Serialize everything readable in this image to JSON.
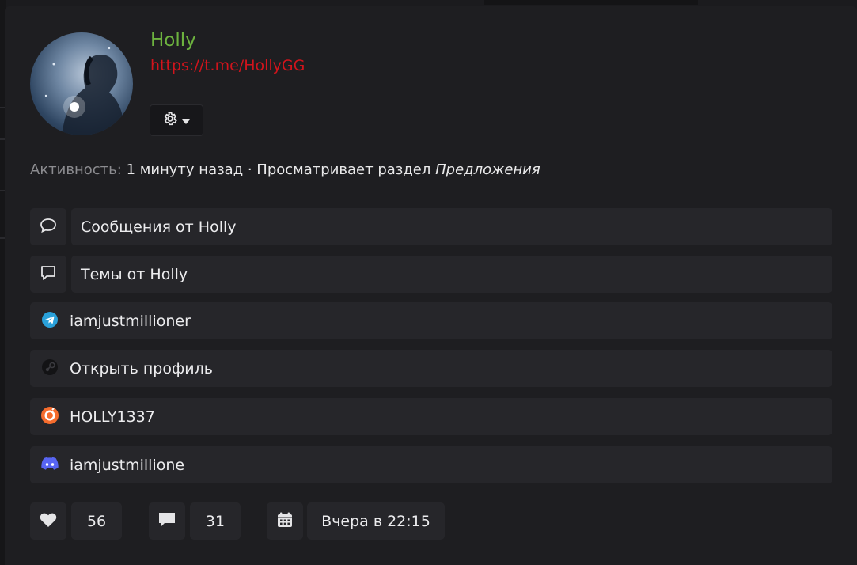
{
  "profile": {
    "name": "Holly",
    "link": "https://t.me/HollyGG"
  },
  "activity": {
    "label": "Активность:",
    "text": "1 минуту назад · Просматривает раздел",
    "section": "Предложения"
  },
  "links": [
    {
      "icon": "chat-bubble-icon",
      "label": "Сообщения от Holly"
    },
    {
      "icon": "topic-icon",
      "label": "Темы от Holly"
    },
    {
      "icon": "telegram-icon",
      "label": "iamjustmillioner"
    },
    {
      "icon": "steam-icon",
      "label": "Открыть профиль"
    },
    {
      "icon": "origin-icon",
      "label": "HOLLY1337"
    },
    {
      "icon": "discord-icon",
      "label": "iamjustmillione"
    }
  ],
  "stats": {
    "likes": "56",
    "messages": "31",
    "joined": "Вчера в 22:15"
  },
  "colors": {
    "name": "#6db33f",
    "link": "#d1141c",
    "telegram": "#2aa1da",
    "origin": "#f56c2d",
    "discord": "#5865f2"
  }
}
